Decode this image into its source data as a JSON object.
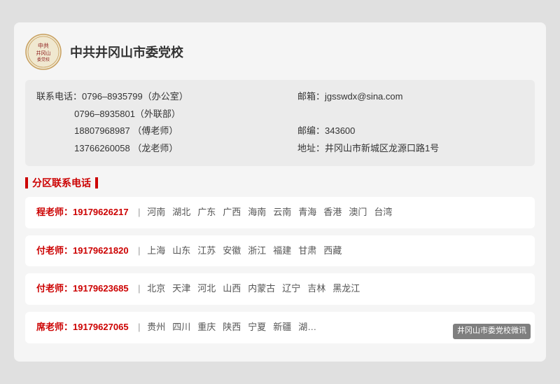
{
  "org": {
    "name": "中共井冈山市委党校",
    "contact_label": "联系电话：",
    "phones": [
      {
        "number": "0796–8935799",
        "note": "（办公室）"
      },
      {
        "number": "0796–8935801",
        "note": "（外联部）"
      },
      {
        "number": "18807968987",
        "note": "（傅老师）"
      },
      {
        "number": "13766260058",
        "note": "（龙老师）"
      }
    ],
    "email_label": "邮箱：",
    "email": "jgsswdx@sina.com",
    "zipcode_label": "邮编：",
    "zipcode": "343600",
    "address_label": "地址：",
    "address": "井冈山市新城区龙源口路1号"
  },
  "section_title": "分区联系电话",
  "contacts": [
    {
      "teacher": "程老师：",
      "phone": "19179626217",
      "regions": [
        "河南",
        "湖北",
        "广东",
        "广西",
        "海南",
        "云南",
        "青海",
        "香港",
        "澳门",
        "台湾"
      ]
    },
    {
      "teacher": "付老师：",
      "phone": "19179621820",
      "regions": [
        "上海",
        "山东",
        "江苏",
        "安徽",
        "浙江",
        "福建",
        "甘肃",
        "西藏"
      ]
    },
    {
      "teacher": "付老师：",
      "phone": "19179623685",
      "regions": [
        "北京",
        "天津",
        "河北",
        "山西",
        "内蒙古",
        "辽宁",
        "吉林",
        "黑龙江"
      ]
    },
    {
      "teacher": "席老师：",
      "phone": "19179627065",
      "regions": [
        "贵州",
        "四川",
        "重庆",
        "陕西",
        "宁夏",
        "新疆",
        "湖…"
      ]
    }
  ],
  "watermark": "井冈山市委党校微讯"
}
